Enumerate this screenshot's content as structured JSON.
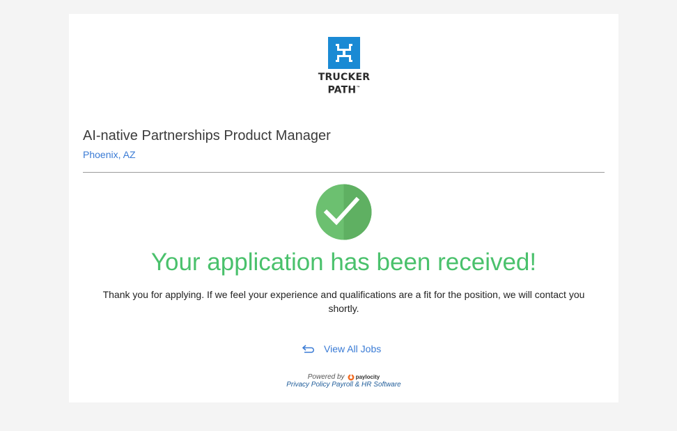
{
  "brand": {
    "name_line1": "TRUCKER",
    "name_line2": "PATH",
    "mark": "™",
    "color": "#1a8ad4"
  },
  "job": {
    "title": "AI-native Partnerships Product Manager",
    "location": "Phoenix, AZ"
  },
  "confirmation": {
    "icon": "check-circle-icon",
    "headline": "Your application has been received!",
    "message": "Thank you for applying. If we feel your experience and qualifications are a fit for the position, we will contact you shortly.",
    "accent": "#4ac16c"
  },
  "actions": {
    "view_all_jobs": "View All Jobs",
    "view_all_jobs_icon": "return-arrow-icon"
  },
  "footer": {
    "powered_by": "Powered by",
    "provider": "paylocity",
    "link_text": "Privacy Policy Payroll & HR Software"
  }
}
